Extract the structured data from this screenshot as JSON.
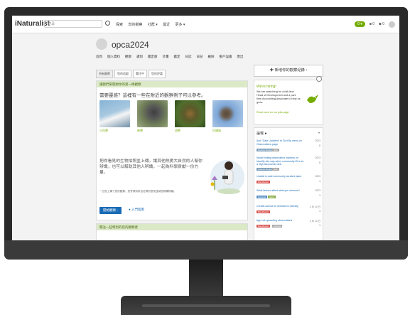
{
  "app": {
    "logo": "iNaturalist",
    "search_placeholder": "搜尋",
    "nav": [
      "探索",
      "您的觀察",
      "社群 ▾",
      "最近",
      "更多 ▾"
    ],
    "nav_right": {
      "badge": "0 ▾",
      "messages": "■ 0",
      "notifications": "◆ 0"
    }
  },
  "profile": {
    "name": "opca2024",
    "subnav": [
      "首頁",
      "個人資料",
      "觀察",
      "識別",
      "鑑定庫",
      "計畫",
      "鑑定",
      "日誌",
      "日記",
      "刪除",
      "帳戶設置",
      "匯出"
    ]
  },
  "tabs": [
    "所有觀察",
    "您的追蹤",
    "關注中",
    "您的評論"
  ],
  "card": {
    "header": "讓我們來開始你的第一條觀察",
    "question": "需要靈感？這裡有一些在附近的觀察例子可以參考。",
    "thumbs": [
      {
        "label": "小白鷺",
        "colors": [
          "#86b4d6",
          "#f5f5f5"
        ]
      },
      {
        "label": "夜鷺",
        "colors": [
          "#6f7d58",
          "#3f3f3f"
        ]
      },
      {
        "label": "池鷺",
        "colors": [
          "#4e6e2c",
          "#8f6b35"
        ]
      },
      {
        "label": "白頭翁",
        "colors": [
          "#7ea7d8",
          "#5a4a3a"
        ]
      }
    ],
    "intro": "把你看見的生物拍照並上傳，讓其他熱愛大自然的人幫你辨識，也可以幫助其他人辨識，一起為科學貢獻一份力量。",
    "note": "一旦您上傳了您的觀察，您會得到來自社群的意見並幫您辨識物種。",
    "cta": "開始觀察 ›",
    "cta2": "● 入門指南",
    "card2_header": "關注一些特別的您的觀察者"
  },
  "right": {
    "new_obs": "✚ 新增你的觀察紀錄 ›",
    "hiring": {
      "title": "We're hiring!",
      "text": "We are searching for a full-time Head of Development and a part-time Accounting Associate to help us grow.",
      "link": "Read more on our jobs page"
    },
    "discuss_title": "論壇 ●",
    "discuss_items": [
      {
        "title": "Add \"Date Updated\" to Sort By menu on Observations page",
        "date": "2023",
        "count": "0",
        "tag": "Feature Request",
        "tag2": "web"
      },
      {
        "title": "Model hiding observation markers on Identify tab map when community ID is at a high taxonomic rank",
        "date": "2023",
        "count": "0",
        "tag": "Feature Request",
        "tag2": "web"
      },
      {
        "title": "Unable to add community curated place",
        "date": "2023",
        "count": "1",
        "tag": "Bug Report",
        "tag2": ""
      },
      {
        "title": "What factors affect what you observe?",
        "date": "2023",
        "count": "1",
        "tag": "General",
        "tag2": "geog"
      },
      {
        "title": "Credits cannot be selected in Identify",
        "date": "2 月 10 日",
        "count": "1",
        "tag": "Bug Report",
        "tag2": ""
      },
      {
        "title": "App not uploading observations",
        "date": "2 月 10 日",
        "count": "1",
        "tag": "Bug Report",
        "tag2": "Android"
      }
    ]
  },
  "colors": {
    "brand": "#74ac00",
    "link": "#1a6bb5",
    "header_bg": "#dbe9c7"
  }
}
